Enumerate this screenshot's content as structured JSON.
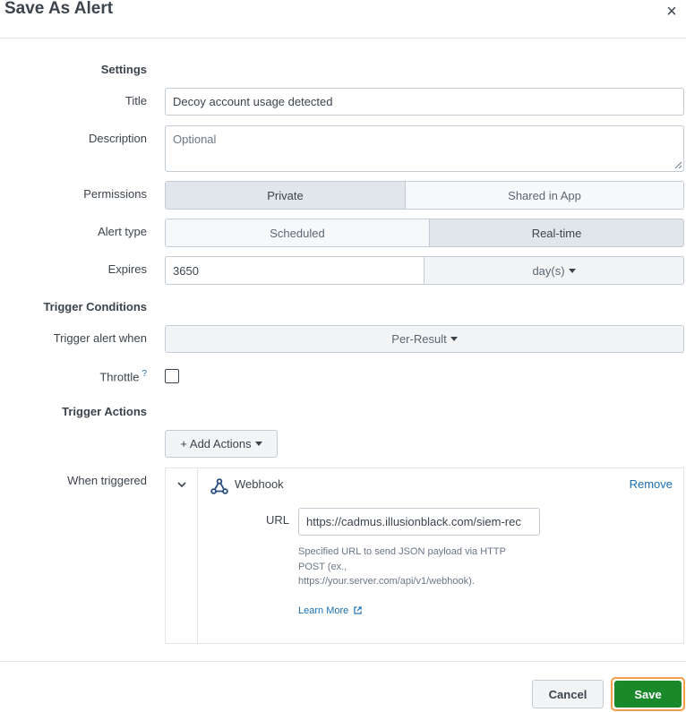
{
  "dialog": {
    "title": "Save As Alert",
    "close": "×"
  },
  "settings": {
    "heading": "Settings",
    "title_label": "Title",
    "title_value": "Decoy account usage detected",
    "description_label": "Description",
    "description_placeholder": "Optional",
    "permissions_label": "Permissions",
    "permissions_options": [
      "Private",
      "Shared in App"
    ],
    "permissions_selected": "Private",
    "alert_type_label": "Alert type",
    "alert_type_options": [
      "Scheduled",
      "Real-time"
    ],
    "alert_type_selected": "Real-time",
    "expires_label": "Expires",
    "expires_value": "3650",
    "expires_unit": "day(s)"
  },
  "trigger_conditions": {
    "heading": "Trigger Conditions",
    "trigger_label": "Trigger alert when",
    "trigger_value": "Per-Result",
    "throttle_label": "Throttle",
    "throttle_help": "?",
    "throttle_checked": false
  },
  "trigger_actions": {
    "heading": "Trigger Actions",
    "add_actions_label": "+ Add Actions",
    "when_triggered_label": "When triggered",
    "action": {
      "name": "Webhook",
      "remove_label": "Remove",
      "url_label": "URL",
      "url_value": "https://cadmus.illusionblack.com/siem-rec",
      "help_text": "Specified URL to send JSON payload via HTTP POST (ex., https://your.server.com/api/v1/webhook).",
      "learn_more": "Learn More"
    }
  },
  "footer": {
    "cancel_label": "Cancel",
    "save_label": "Save"
  },
  "colors": {
    "primary_green": "#1a8929",
    "focus_orange": "#f0a04b",
    "link_blue": "#1a6fb3"
  }
}
